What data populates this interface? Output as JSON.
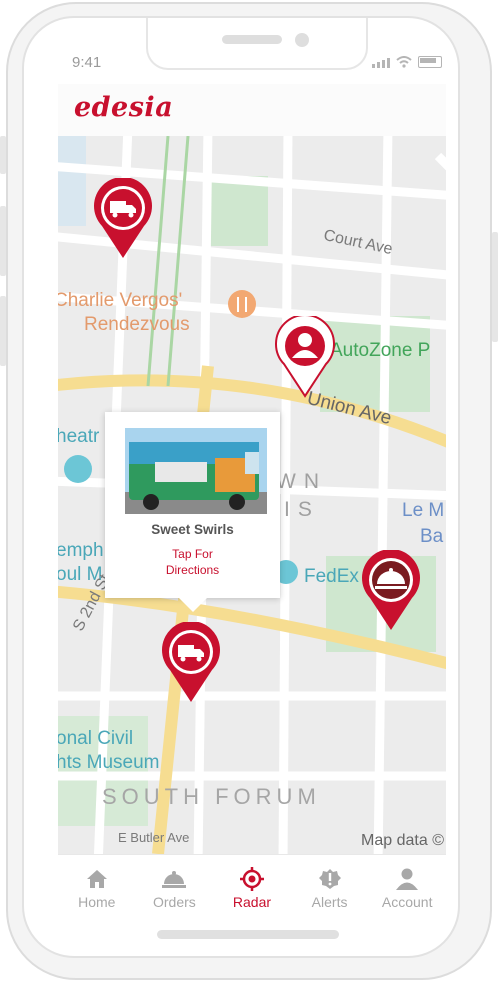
{
  "status": {
    "time": "9:41"
  },
  "app": {
    "logo": "edesia"
  },
  "map": {
    "labels": {
      "court_ave": "Court Ave",
      "charlie_1": "Charlie Vergos'",
      "charlie_2": "Rendezvous",
      "autozone": "AutoZone P",
      "union_ave": "Union Ave",
      "theatre": "heatr",
      "downtown_1": "WN",
      "downtown_2": "IS",
      "le_m": "Le M",
      "ba": "Ba",
      "memphis_1": "emph",
      "memphis_2": "oul M",
      "fedex": "FedEx",
      "s2nd": "S 2nd St",
      "civil_1": "onal Civil",
      "civil_2": "hts Museum",
      "south_forum": "SOUTH FORUM",
      "butler": "E Butler Ave",
      "map_data": "Map data ©"
    },
    "popup": {
      "vendor_name": "Sweet Swirls",
      "cta_line1": "Tap For",
      "cta_line2": "Directions"
    }
  },
  "tabs": [
    {
      "label": "Home",
      "icon": "home-icon"
    },
    {
      "label": "Orders",
      "icon": "cloche-icon"
    },
    {
      "label": "Radar",
      "icon": "radar-icon"
    },
    {
      "label": "Alerts",
      "icon": "alert-icon"
    },
    {
      "label": "Account",
      "icon": "user-icon"
    }
  ],
  "colors": {
    "accent": "#c8102e",
    "inactive": "#a8a8a8"
  }
}
